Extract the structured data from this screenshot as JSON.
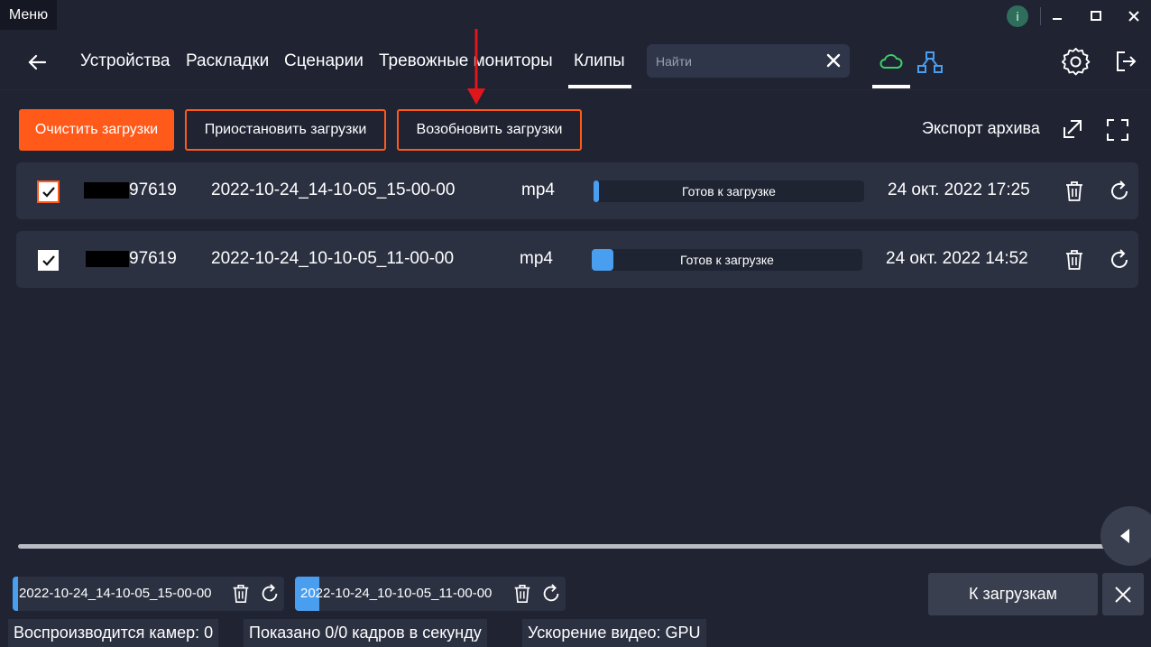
{
  "titlebar": {
    "menu_label": "Меню",
    "info_label": "i"
  },
  "nav": {
    "items": [
      "Устройства",
      "Раскладки",
      "Сценарии",
      "Тревожные мониторы",
      "Клипы"
    ],
    "active": "Клипы",
    "search_placeholder": "Найти"
  },
  "toolbar": {
    "clear_label": "Очистить загрузки",
    "pause_label": "Приостановить загрузки",
    "resume_label": "Возобновить загрузки",
    "export_label": "Экспорт архива"
  },
  "clips": [
    {
      "checked": true,
      "device": "97619",
      "name": "2022-10-24_14-10-05_15-00-00",
      "format": "mp4",
      "status": "Готов к загрузке",
      "progress": 0.02,
      "date": "24 окт. 2022 17:25"
    },
    {
      "checked": true,
      "device": "97619",
      "name": "2022-10-24_10-10-05_11-00-00",
      "format": "mp4",
      "status": "Готов к загрузке",
      "progress": 0.08,
      "date": "24 окт. 2022 14:52"
    }
  ],
  "queue": [
    {
      "name": "2022-10-24_14-10-05_15-00-00",
      "progress": 0.02
    },
    {
      "name": "2022-10-24_10-10-05_11-00-00",
      "progress": 0.09
    }
  ],
  "bottom": {
    "to_downloads_label": "К загрузкам"
  },
  "status": {
    "cameras": "Воспроизводится камер: 0",
    "fps": "Показано 0/0 кадров в секунду",
    "accel": "Ускорение видео: GPU"
  },
  "colors": {
    "accent": "#ff5a1a",
    "progress": "#4a9ef0",
    "cloud": "#3fcf6a",
    "network": "#4a9ef0"
  },
  "icons": [
    "back-arrow-icon",
    "close-icon",
    "cloud-icon",
    "network-icon",
    "gear-icon",
    "logout-icon",
    "export-icon",
    "fullscreen-icon",
    "trash-icon",
    "refresh-icon",
    "chevron-left-icon",
    "minimize-icon",
    "maximize-icon"
  ]
}
